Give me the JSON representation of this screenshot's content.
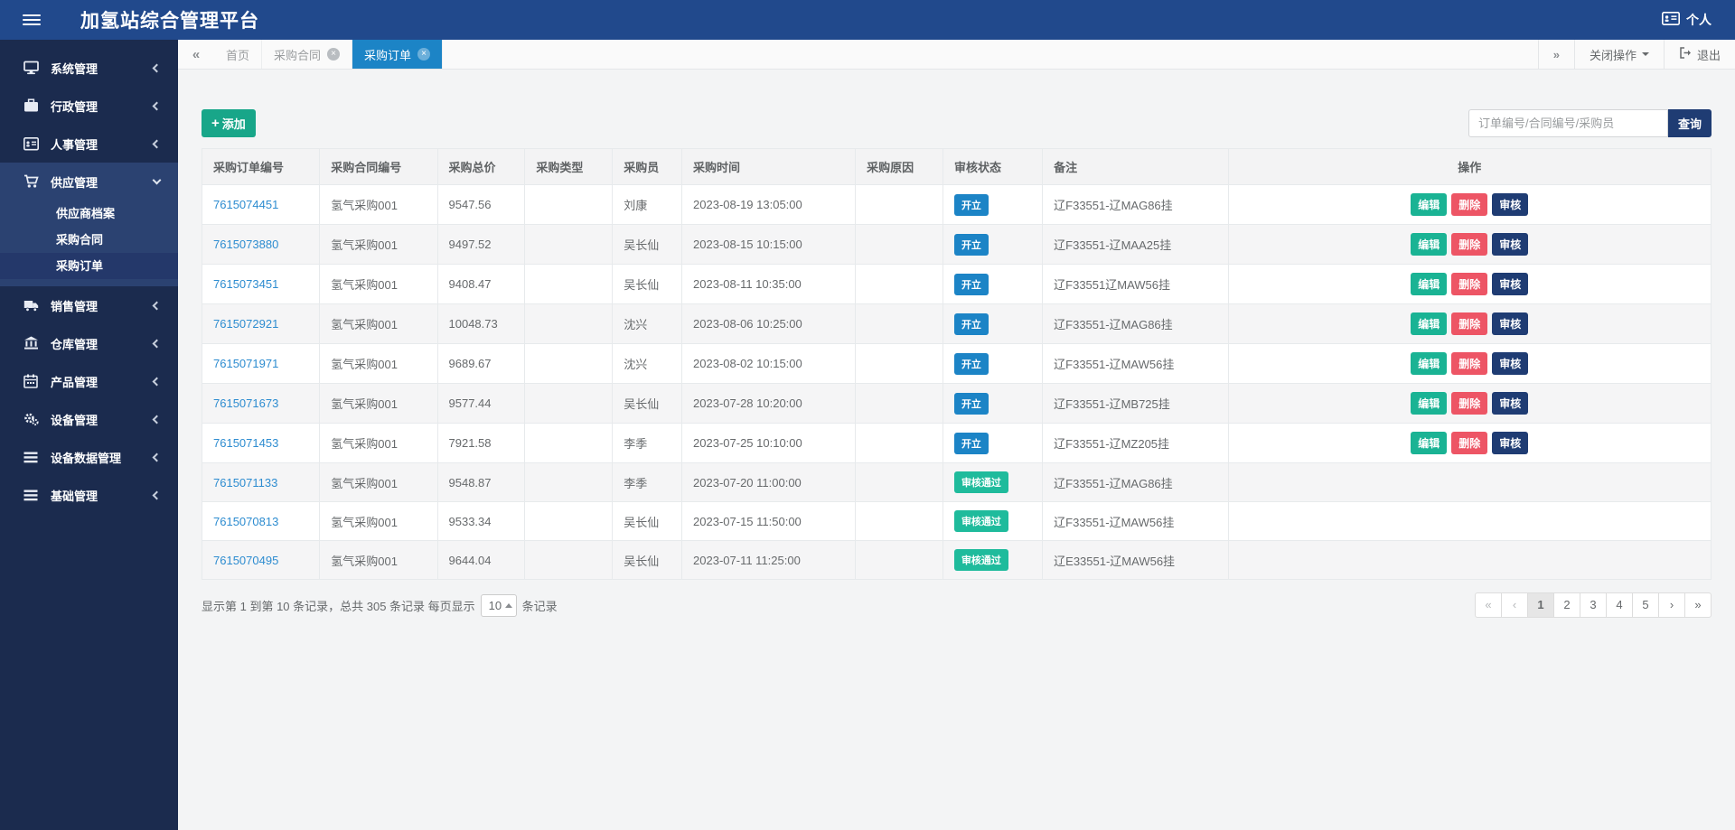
{
  "app": {
    "title": "加氢站综合管理平台",
    "user_label": "个人"
  },
  "tabbar": {
    "scroll_left": "«",
    "scroll_right": "»",
    "tabs": [
      {
        "label": "首页",
        "closable": false,
        "active": false
      },
      {
        "label": "采购合同",
        "closable": true,
        "active": false
      },
      {
        "label": "采购订单",
        "closable": true,
        "active": true
      }
    ],
    "close_ops_label": "关闭操作",
    "logout_label": "退出"
  },
  "sidebar": {
    "items": [
      {
        "label": "系统管理",
        "icon": "monitor-icon",
        "state": "collapsed"
      },
      {
        "label": "行政管理",
        "icon": "briefcase-icon",
        "state": "collapsed"
      },
      {
        "label": "人事管理",
        "icon": "id-card-icon",
        "state": "collapsed"
      },
      {
        "label": "供应管理",
        "icon": "cart-icon",
        "state": "expanded",
        "children": [
          "供应商档案",
          "采购合同",
          "采购订单"
        ],
        "active_child": "采购订单"
      },
      {
        "label": "销售管理",
        "icon": "truck-icon",
        "state": "collapsed"
      },
      {
        "label": "仓库管理",
        "icon": "bank-icon",
        "state": "collapsed"
      },
      {
        "label": "产品管理",
        "icon": "calendar-icon",
        "state": "collapsed"
      },
      {
        "label": "设备管理",
        "icon": "gears-icon",
        "state": "collapsed"
      },
      {
        "label": "设备数据管理",
        "icon": "list-icon",
        "state": "collapsed"
      },
      {
        "label": "基础管理",
        "icon": "list-icon",
        "state": "collapsed"
      }
    ]
  },
  "toolbar": {
    "add_label": "添加",
    "add_icon": "+",
    "search_placeholder": "订单编号/合同编号/采购员",
    "search_value": "",
    "search_label": "查询"
  },
  "table": {
    "columns": [
      "采购订单编号",
      "采购合同编号",
      "采购总价",
      "采购类型",
      "采购员",
      "采购时间",
      "采购原因",
      "审核状态",
      "备注",
      "操作"
    ],
    "action_labels": {
      "edit": "编辑",
      "delete": "删除",
      "audit": "审核"
    },
    "status_colors": {
      "open": "#1c84c6",
      "passed": "#1fbb9c"
    },
    "rows": [
      {
        "order_no": "7615074451",
        "contract_no": "氢气采购001",
        "total": "9547.56",
        "type": "",
        "buyer": "刘康",
        "time": "2023-08-19 13:05:00",
        "reason": "",
        "status": "开立",
        "status_type": "open",
        "remark": "辽F33551-辽MAG86挂",
        "has_actions": true
      },
      {
        "order_no": "7615073880",
        "contract_no": "氢气采购001",
        "total": "9497.52",
        "type": "",
        "buyer": "吴长仙",
        "time": "2023-08-15 10:15:00",
        "reason": "",
        "status": "开立",
        "status_type": "open",
        "remark": "辽F33551-辽MAA25挂",
        "has_actions": true
      },
      {
        "order_no": "7615073451",
        "contract_no": "氢气采购001",
        "total": "9408.47",
        "type": "",
        "buyer": "吴长仙",
        "time": "2023-08-11 10:35:00",
        "reason": "",
        "status": "开立",
        "status_type": "open",
        "remark": "辽F33551辽MAW56挂",
        "has_actions": true
      },
      {
        "order_no": "7615072921",
        "contract_no": "氢气采购001",
        "total": "10048.73",
        "type": "",
        "buyer": "沈兴",
        "time": "2023-08-06 10:25:00",
        "reason": "",
        "status": "开立",
        "status_type": "open",
        "remark": "辽F33551-辽MAG86挂",
        "has_actions": true
      },
      {
        "order_no": "7615071971",
        "contract_no": "氢气采购001",
        "total": "9689.67",
        "type": "",
        "buyer": "沈兴",
        "time": "2023-08-02 10:15:00",
        "reason": "",
        "status": "开立",
        "status_type": "open",
        "remark": "辽F33551-辽MAW56挂",
        "has_actions": true
      },
      {
        "order_no": "7615071673",
        "contract_no": "氢气采购001",
        "total": "9577.44",
        "type": "",
        "buyer": "吴长仙",
        "time": "2023-07-28 10:20:00",
        "reason": "",
        "status": "开立",
        "status_type": "open",
        "remark": "辽F33551-辽MB725挂",
        "has_actions": true
      },
      {
        "order_no": "7615071453",
        "contract_no": "氢气采购001",
        "total": "7921.58",
        "type": "",
        "buyer": "李季",
        "time": "2023-07-25 10:10:00",
        "reason": "",
        "status": "开立",
        "status_type": "open",
        "remark": "辽F33551-辽MZ205挂",
        "has_actions": true
      },
      {
        "order_no": "7615071133",
        "contract_no": "氢气采购001",
        "total": "9548.87",
        "type": "",
        "buyer": "李季",
        "time": "2023-07-20 11:00:00",
        "reason": "",
        "status": "审核通过",
        "status_type": "passed",
        "remark": "辽F33551-辽MAG86挂",
        "has_actions": false
      },
      {
        "order_no": "7615070813",
        "contract_no": "氢气采购001",
        "total": "9533.34",
        "type": "",
        "buyer": "吴长仙",
        "time": "2023-07-15 11:50:00",
        "reason": "",
        "status": "审核通过",
        "status_type": "passed",
        "remark": "辽F33551-辽MAW56挂",
        "has_actions": false
      },
      {
        "order_no": "7615070495",
        "contract_no": "氢气采购001",
        "total": "9644.04",
        "type": "",
        "buyer": "吴长仙",
        "time": "2023-07-11 11:25:00",
        "reason": "",
        "status": "审核通过",
        "status_type": "passed",
        "remark": "辽E33551-辽MAW56挂",
        "has_actions": false
      }
    ]
  },
  "pagination": {
    "summary_prefix": "显示第 1 到第 10 条记录，总共 305 条记录 每页显示",
    "page_size": "10",
    "summary_suffix": "条记录",
    "pages": [
      {
        "label": "«",
        "state": "disabled"
      },
      {
        "label": "‹",
        "state": "disabled"
      },
      {
        "label": "1",
        "state": "active"
      },
      {
        "label": "2",
        "state": "normal"
      },
      {
        "label": "3",
        "state": "normal"
      },
      {
        "label": "4",
        "state": "normal"
      },
      {
        "label": "5",
        "state": "normal"
      },
      {
        "label": "›",
        "state": "normal"
      },
      {
        "label": "»",
        "state": "normal"
      }
    ]
  }
}
